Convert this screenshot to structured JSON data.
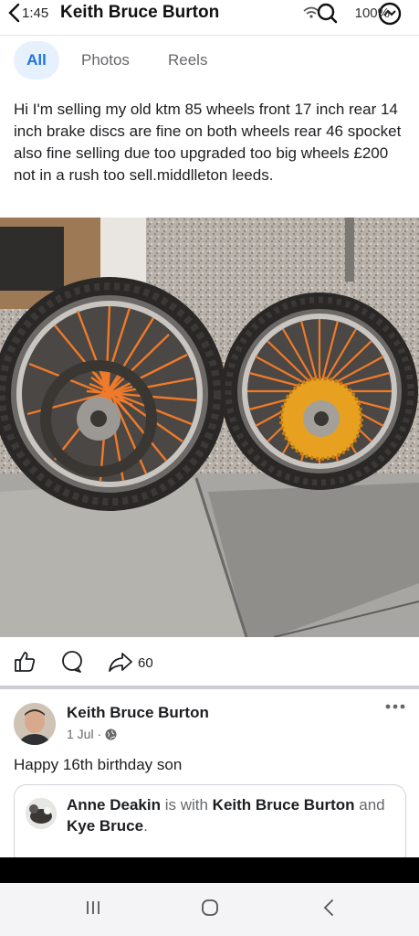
{
  "status_bar": {
    "time": "1:45",
    "title": "Keith Bruce Burton",
    "battery": "100%"
  },
  "tabs": [
    {
      "label": "All",
      "active": true
    },
    {
      "label": "Photos",
      "active": false
    },
    {
      "label": "Reels",
      "active": false
    }
  ],
  "post": {
    "text": "Hi I'm selling my old ktm 85 wheels front 17 inch rear 14 inch brake discs are fine on both wheels rear 46 spocket also fine selling due too upgraded too big wheels £200 not in a rush too sell.middlleton leeds.",
    "image_alt": "Two motocross wheels with orange spokes leaning against a wall",
    "share_count": "60"
  },
  "post2": {
    "author": "Keith Bruce Burton",
    "date": "1 Jul",
    "privacy_icon": "globe-icon",
    "text": "Happy 16th birthday son",
    "shared": {
      "name": "Anne Deakin",
      "with_text": " is with ",
      "with_name": "Keith Bruce Burton",
      "and_text": " and ",
      "and_name": "Kye Bruce",
      "end": "."
    }
  },
  "colors": {
    "accent": "#1b74e4",
    "tab_active_bg": "#e7f0fd",
    "muted": "#65676b",
    "spokes": "#f07a2a",
    "sprocket": "#e8a020"
  },
  "nav_bar": {
    "icons": [
      "recent-apps-icon",
      "home-icon",
      "back-icon"
    ]
  }
}
